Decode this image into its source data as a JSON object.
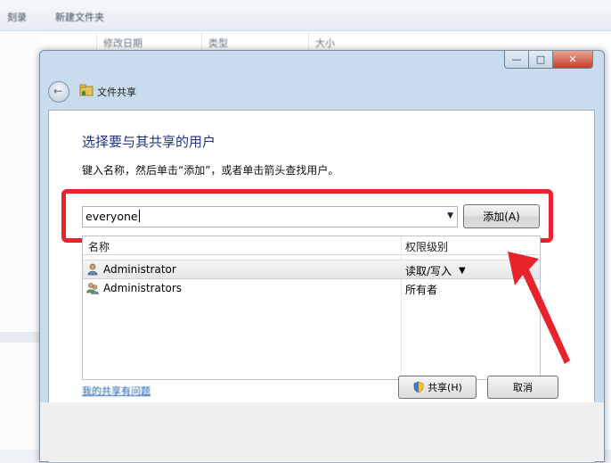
{
  "background": {
    "toolbar_items": [
      "刻录",
      "新建文件夹"
    ],
    "columns": [
      "修改日期",
      "类型",
      "大小"
    ]
  },
  "dialog": {
    "title": "文件共享",
    "window_buttons": {
      "minimize": "—",
      "maximize": "□",
      "close": "✕"
    },
    "heading": "选择要与其共享的用户",
    "instruction": "键入名称，然后单击“添加”，或者单击箭头查找用户。",
    "input": {
      "value": "everyone"
    },
    "add_button": "添加(A)",
    "table": {
      "headers": {
        "name": "名称",
        "permission": "权限级别"
      },
      "rows": [
        {
          "name": "Administrator",
          "permission": "读取/写入",
          "selected": true,
          "icon": "user-icon"
        },
        {
          "name": "Administrators",
          "permission": "所有者",
          "selected": false,
          "icon": "group-icon"
        }
      ]
    },
    "help_link": "我的共享有问题",
    "share_button": "共享(H)",
    "cancel_button": "取消"
  },
  "colors": {
    "highlight": "#e8232b",
    "heading": "#1e3287"
  }
}
